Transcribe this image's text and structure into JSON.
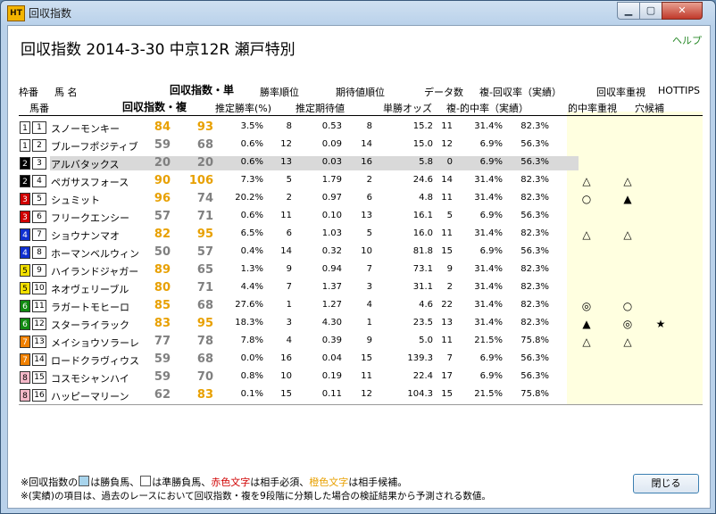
{
  "window": {
    "title": "回収指数"
  },
  "heading": "回収指数  2014-3-30 中京12R 瀬戸特別",
  "help_link": "ヘルプ",
  "headers": {
    "waku": "枠番",
    "uma_name": "馬  名",
    "umaban": "馬番",
    "index_tan": "回収指数・単",
    "index_fuku": "回収指数・複",
    "win_rank": "勝率順位",
    "exp_rank": "期待値順位",
    "data_count": "データ数",
    "fuku_return": "複-回収率（実績）",
    "est_win": "推定勝率(%)",
    "est_exp": "推定期待値",
    "odds": "単勝オッズ",
    "hit_rate": "複-的中率（実績）",
    "return_focus": "回収率重視",
    "hottips": "HOTTIPS",
    "hit_focus": "的中率重視",
    "dark_horse": "穴候補"
  },
  "colors": {
    "orange": "#e8a000",
    "gray": "#808080",
    "accent": "#2a8a2a"
  },
  "horses": [
    {
      "waku": "1",
      "uma": "1",
      "name": "スノーモンキー",
      "tan": "84",
      "fuku": "93",
      "tan_c": "o",
      "fuku_c": "o",
      "est": "3.5%",
      "wr": "8",
      "exp": "0.53",
      "er": "8",
      "odds": "15.2",
      "dc": "11",
      "hit": "31.4%",
      "ret": "82.3%",
      "m1": "",
      "m2": "",
      "m3": "",
      "wc": "#fff",
      "wt": "#000"
    },
    {
      "waku": "1",
      "uma": "2",
      "name": "ブルーフポジティブ",
      "tan": "59",
      "fuku": "68",
      "tan_c": "g",
      "fuku_c": "g",
      "est": "0.6%",
      "wr": "12",
      "exp": "0.09",
      "er": "14",
      "odds": "15.0",
      "dc": "12",
      "hit": "6.9%",
      "ret": "56.3%",
      "m1": "",
      "m2": "",
      "m3": "",
      "wc": "#fff",
      "wt": "#000"
    },
    {
      "waku": "2",
      "uma": "3",
      "name": "アルバタックス",
      "tan": "20",
      "fuku": "20",
      "tan_c": "g",
      "fuku_c": "g",
      "est": "0.6%",
      "wr": "13",
      "exp": "0.03",
      "er": "16",
      "odds": "5.8",
      "dc": "0",
      "hit": "6.9%",
      "ret": "56.3%",
      "m1": "",
      "m2": "",
      "m3": "",
      "wc": "#000",
      "wt": "#fff",
      "shaded": true
    },
    {
      "waku": "2",
      "uma": "4",
      "name": "ペガサスフォース",
      "tan": "90",
      "fuku": "106",
      "tan_c": "o",
      "fuku_c": "o",
      "est": "7.3%",
      "wr": "5",
      "exp": "1.79",
      "er": "2",
      "odds": "24.6",
      "dc": "14",
      "hit": "31.4%",
      "ret": "82.3%",
      "m1": "△",
      "m2": "△",
      "m3": "",
      "wc": "#000",
      "wt": "#fff"
    },
    {
      "waku": "3",
      "uma": "5",
      "name": "シュミット",
      "tan": "96",
      "fuku": "74",
      "tan_c": "o",
      "fuku_c": "g",
      "est": "20.2%",
      "wr": "2",
      "exp": "0.97",
      "er": "6",
      "odds": "4.8",
      "dc": "11",
      "hit": "31.4%",
      "ret": "82.3%",
      "m1": "○",
      "m2": "▲",
      "m3": "",
      "wc": "#d00000",
      "wt": "#fff"
    },
    {
      "waku": "3",
      "uma": "6",
      "name": "フリークエンシー",
      "tan": "57",
      "fuku": "71",
      "tan_c": "g",
      "fuku_c": "g",
      "est": "0.6%",
      "wr": "11",
      "exp": "0.10",
      "er": "13",
      "odds": "16.1",
      "dc": "5",
      "hit": "6.9%",
      "ret": "56.3%",
      "m1": "",
      "m2": "",
      "m3": "",
      "wc": "#d00000",
      "wt": "#fff"
    },
    {
      "waku": "4",
      "uma": "7",
      "name": "ショウナンマオ",
      "tan": "82",
      "fuku": "95",
      "tan_c": "o",
      "fuku_c": "o",
      "est": "6.5%",
      "wr": "6",
      "exp": "1.03",
      "er": "5",
      "odds": "16.0",
      "dc": "11",
      "hit": "31.4%",
      "ret": "82.3%",
      "m1": "△",
      "m2": "△",
      "m3": "",
      "wc": "#1030d0",
      "wt": "#fff"
    },
    {
      "waku": "4",
      "uma": "8",
      "name": "ホーマンベルウィン",
      "tan": "50",
      "fuku": "57",
      "tan_c": "g",
      "fuku_c": "g",
      "est": "0.4%",
      "wr": "14",
      "exp": "0.32",
      "er": "10",
      "odds": "81.8",
      "dc": "15",
      "hit": "6.9%",
      "ret": "56.3%",
      "m1": "",
      "m2": "",
      "m3": "",
      "wc": "#1030d0",
      "wt": "#fff"
    },
    {
      "waku": "5",
      "uma": "9",
      "name": "ハイランドジャガー",
      "tan": "89",
      "fuku": "65",
      "tan_c": "o",
      "fuku_c": "g",
      "est": "1.3%",
      "wr": "9",
      "exp": "0.94",
      "er": "7",
      "odds": "73.1",
      "dc": "9",
      "hit": "31.4%",
      "ret": "82.3%",
      "m1": "",
      "m2": "",
      "m3": "",
      "wc": "#f2e000",
      "wt": "#000"
    },
    {
      "waku": "5",
      "uma": "10",
      "name": "ネオヴェリーブル",
      "tan": "80",
      "fuku": "71",
      "tan_c": "o",
      "fuku_c": "g",
      "est": "4.4%",
      "wr": "7",
      "exp": "1.37",
      "er": "3",
      "odds": "31.1",
      "dc": "2",
      "hit": "31.4%",
      "ret": "82.3%",
      "m1": "",
      "m2": "",
      "m3": "",
      "wc": "#f2e000",
      "wt": "#000"
    },
    {
      "waku": "6",
      "uma": "11",
      "name": "ラガートモヒーロ",
      "tan": "85",
      "fuku": "68",
      "tan_c": "o",
      "fuku_c": "g",
      "est": "27.6%",
      "wr": "1",
      "exp": "1.27",
      "er": "4",
      "odds": "4.6",
      "dc": "22",
      "hit": "31.4%",
      "ret": "82.3%",
      "m1": "◎",
      "m2": "○",
      "m3": "",
      "wc": "#108a10",
      "wt": "#fff"
    },
    {
      "waku": "6",
      "uma": "12",
      "name": "スターライラック",
      "tan": "83",
      "fuku": "95",
      "tan_c": "o",
      "fuku_c": "o",
      "est": "18.3%",
      "wr": "3",
      "exp": "4.30",
      "er": "1",
      "odds": "23.5",
      "dc": "13",
      "hit": "31.4%",
      "ret": "82.3%",
      "m1": "▲",
      "m2": "◎",
      "m3": "★",
      "wc": "#108a10",
      "wt": "#fff"
    },
    {
      "waku": "7",
      "uma": "13",
      "name": "メイショウソラーレ",
      "tan": "77",
      "fuku": "78",
      "tan_c": "g",
      "fuku_c": "g",
      "est": "7.8%",
      "wr": "4",
      "exp": "0.39",
      "er": "9",
      "odds": "5.0",
      "dc": "11",
      "hit": "21.5%",
      "ret": "75.8%",
      "m1": "△",
      "m2": "△",
      "m3": "",
      "wc": "#f08000",
      "wt": "#fff"
    },
    {
      "waku": "7",
      "uma": "14",
      "name": "ロードクラヴィウス",
      "tan": "59",
      "fuku": "68",
      "tan_c": "g",
      "fuku_c": "g",
      "est": "0.0%",
      "wr": "16",
      "exp": "0.04",
      "er": "15",
      "odds": "139.3",
      "dc": "7",
      "hit": "6.9%",
      "ret": "56.3%",
      "m1": "",
      "m2": "",
      "m3": "",
      "wc": "#f08000",
      "wt": "#fff"
    },
    {
      "waku": "8",
      "uma": "15",
      "name": "コスモシャンハイ",
      "tan": "59",
      "fuku": "70",
      "tan_c": "g",
      "fuku_c": "g",
      "est": "0.8%",
      "wr": "10",
      "exp": "0.19",
      "er": "11",
      "odds": "22.4",
      "dc": "17",
      "hit": "6.9%",
      "ret": "56.3%",
      "m1": "",
      "m2": "",
      "m3": "",
      "wc": "#f4b8c8",
      "wt": "#000"
    },
    {
      "waku": "8",
      "uma": "16",
      "name": "ハッピーマリーン",
      "tan": "62",
      "fuku": "83",
      "tan_c": "g",
      "fuku_c": "o",
      "est": "0.1%",
      "wr": "15",
      "exp": "0.11",
      "er": "12",
      "odds": "104.3",
      "dc": "15",
      "hit": "21.5%",
      "ret": "75.8%",
      "m1": "",
      "m2": "",
      "m3": "",
      "wc": "#f4b8c8",
      "wt": "#000"
    }
  ],
  "footnotes": {
    "line1_a": "※回収指数の",
    "line1_b": "は勝負馬、",
    "line1_c": "は準勝負馬、",
    "line1_red": "赤色文字",
    "line1_d": "は相手必須、",
    "line1_orange": "橙色文字",
    "line1_e": "は相手候補。",
    "line2": "※(実績)の項目は、過去のレースにおいて回収指数・複を9段階に分類した場合の検証結果から予測される数値。"
  },
  "close_button": "閉じる"
}
